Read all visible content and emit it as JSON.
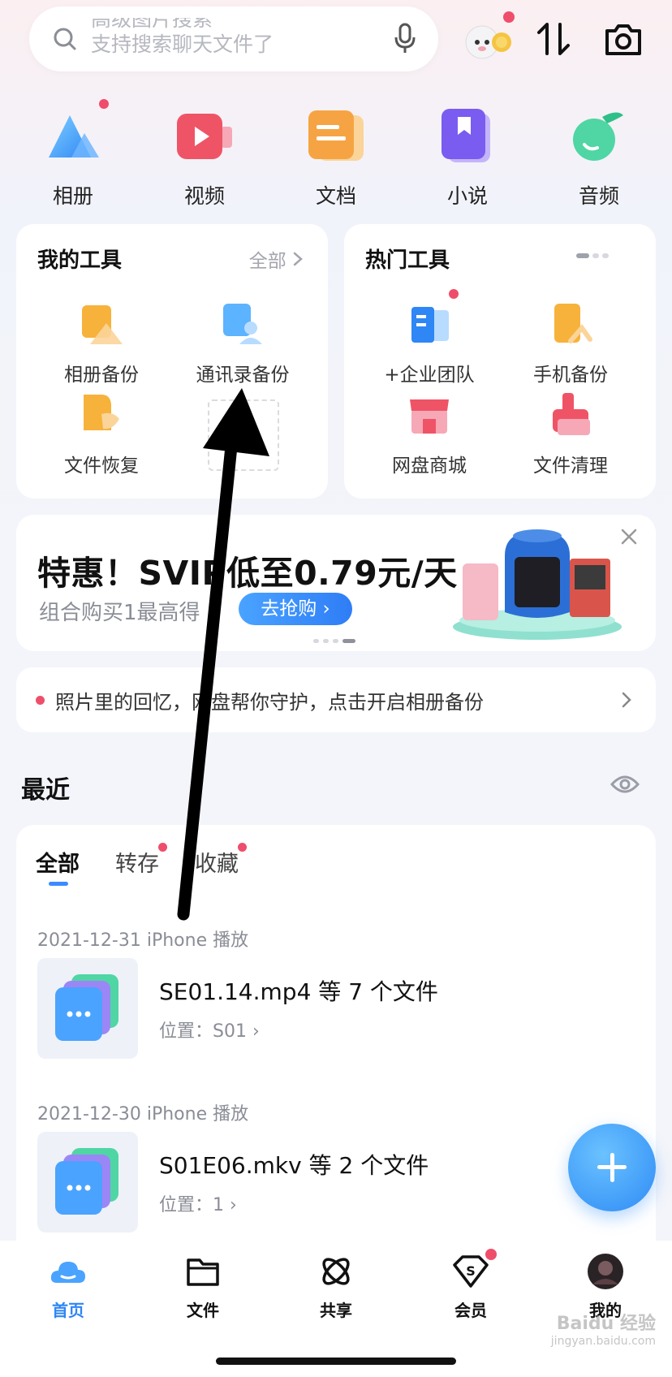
{
  "search": {
    "placeholder_line1": "高级图片搜索",
    "placeholder_line2": "支持搜索聊天文件了"
  },
  "categories": [
    {
      "label": "相册",
      "icon": "album-icon",
      "badge": true
    },
    {
      "label": "视频",
      "icon": "video-icon",
      "badge": false
    },
    {
      "label": "文档",
      "icon": "document-icon",
      "badge": false
    },
    {
      "label": "小说",
      "icon": "novel-icon",
      "badge": false
    },
    {
      "label": "音频",
      "icon": "audio-icon",
      "badge": false
    }
  ],
  "my_tools": {
    "title": "我的工具",
    "all_label": "全部",
    "items": [
      {
        "label": "相册备份",
        "icon": "album-backup-icon"
      },
      {
        "label": "通讯录备份",
        "icon": "contacts-backup-icon"
      },
      {
        "label": "文件恢复",
        "icon": "file-recovery-icon"
      }
    ]
  },
  "hot_tools": {
    "title": "热门工具",
    "items": [
      {
        "label": "+企业团队",
        "icon": "enterprise-team-icon",
        "badge": true
      },
      {
        "label": "手机备份",
        "icon": "phone-backup-icon",
        "badge": false
      },
      {
        "label": "网盘商城",
        "icon": "store-icon",
        "badge": false
      },
      {
        "label": "文件清理",
        "icon": "file-cleanup-icon",
        "badge": false
      }
    ]
  },
  "promo": {
    "title": "特惠！SVIP低至0.79元/天",
    "subtitle": "组合购买1最高得",
    "button": "去抢购"
  },
  "tip": {
    "text": "照片里的回忆，网盘帮你守护，点击开启相册备份"
  },
  "recent": {
    "title": "最近",
    "tabs": [
      {
        "label": "全部",
        "active": true,
        "badge": false
      },
      {
        "label": "转存",
        "active": false,
        "badge": true
      },
      {
        "label": "收藏",
        "active": false,
        "badge": true
      }
    ],
    "groups": [
      {
        "date": "2021-12-31 iPhone 播放",
        "name": "SE01.14.mp4 等 7 个文件",
        "location": "位置：S01"
      },
      {
        "date": "2021-12-30 iPhone 播放",
        "name": "S01E06.mkv 等 2 个文件",
        "location": "位置：1"
      }
    ]
  },
  "bottom_nav": [
    {
      "label": "首页",
      "icon": "home-cloud-icon",
      "active": true
    },
    {
      "label": "文件",
      "icon": "folder-icon",
      "active": false
    },
    {
      "label": "共享",
      "icon": "share-icon",
      "active": false
    },
    {
      "label": "会员",
      "icon": "vip-icon",
      "active": false,
      "badge": true
    },
    {
      "label": "我的",
      "icon": "profile-avatar-icon",
      "active": false
    }
  ],
  "watermark": {
    "brand": "Baidu 经验",
    "url": "jingyan.baidu.com"
  },
  "colors": {
    "accent": "#2e86f5",
    "badge": "#ef4e6b"
  }
}
